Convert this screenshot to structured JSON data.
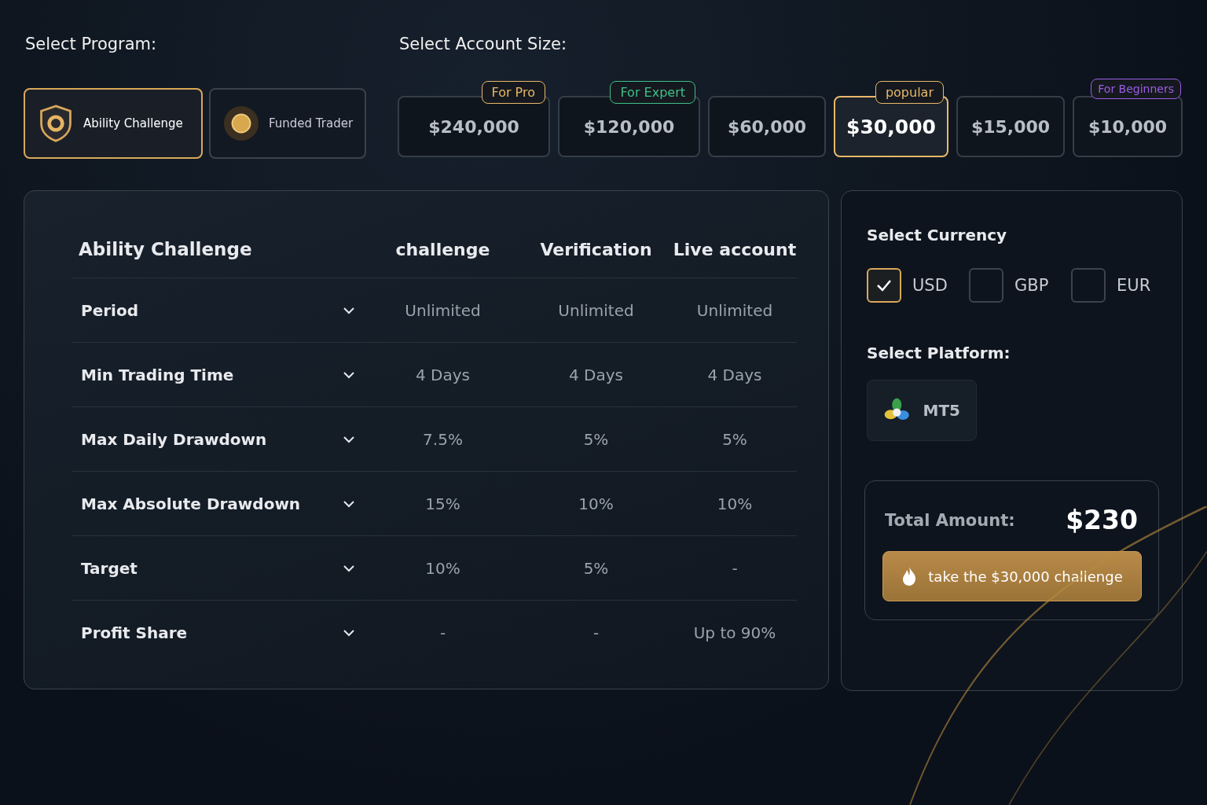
{
  "program": {
    "label": "Select Program:",
    "options": [
      {
        "label": "Ability Challenge",
        "selected": true
      },
      {
        "label": "Funded Trader",
        "selected": false
      }
    ]
  },
  "account_size": {
    "label": "Select Account Size:",
    "options": [
      {
        "amount": "$240,000",
        "badge": "For Pro",
        "color": "#e8b86a",
        "selected": false
      },
      {
        "amount": "$120,000",
        "badge": "For Expert",
        "color": "#3fbf86",
        "selected": false
      },
      {
        "amount": "$60,000",
        "selected": false
      },
      {
        "amount": "$30,000",
        "badge": "popular",
        "color": "#e8b86a",
        "selected": true
      },
      {
        "amount": "$15,000",
        "selected": false
      },
      {
        "amount": "$10,000",
        "badge": "For Beginners",
        "color": "#9b5de5",
        "selected": false
      }
    ]
  },
  "table": {
    "title": "Ability Challenge",
    "columns": [
      "challenge",
      "Verification",
      "Live account"
    ],
    "rows": [
      {
        "label": "Period",
        "values": [
          "Unlimited",
          "Unlimited",
          "Unlimited"
        ],
        "expanded": false
      },
      {
        "label": "Min Trading Time",
        "values": [
          "4 Days",
          "4 Days",
          "4 Days"
        ],
        "expanded": false
      },
      {
        "label": "Max Daily Drawdown",
        "values": [
          "7.5%",
          "5%",
          "5%"
        ],
        "expanded": false
      },
      {
        "label": "Max Absolute Drawdown",
        "values": [
          "15%",
          "10%",
          "10%"
        ],
        "expanded": false
      },
      {
        "label": "Target",
        "values": [
          "10%",
          "5%",
          "-"
        ],
        "expanded": false
      },
      {
        "label": "Profit Share",
        "values": [
          "-",
          "-",
          "Up to 90%"
        ],
        "expanded": false
      }
    ]
  },
  "currency": {
    "label": "Select Currency",
    "options": [
      {
        "label": "USD",
        "checked": true
      },
      {
        "label": "GBP",
        "checked": false
      },
      {
        "label": "EUR",
        "checked": false
      }
    ]
  },
  "platform": {
    "label": "Select Platform:",
    "options": [
      {
        "label": "MT5"
      }
    ]
  },
  "total": {
    "label": "Total Amount:",
    "value": "$230",
    "button": "take the $30,000 challenge"
  }
}
